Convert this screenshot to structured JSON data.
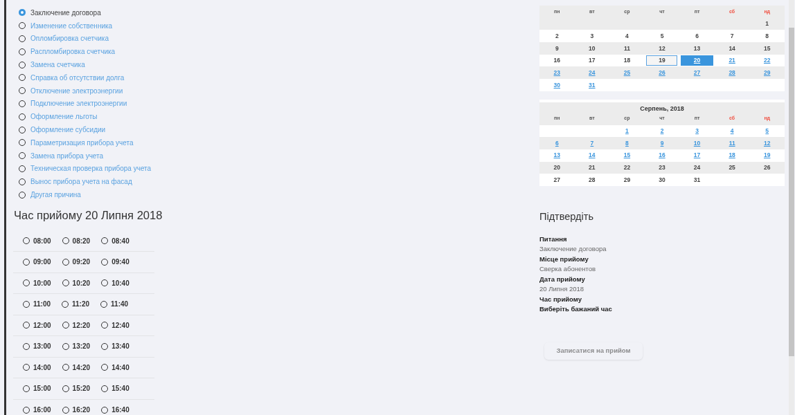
{
  "services": [
    {
      "label": "Заключение договора",
      "selected": true
    },
    {
      "label": "Изменение собственника",
      "selected": false
    },
    {
      "label": "Опломбировка счетчика",
      "selected": false
    },
    {
      "label": "Распломбировка счетчика",
      "selected": false
    },
    {
      "label": "Замена счетчика",
      "selected": false
    },
    {
      "label": "Справка об отсутствии долга",
      "selected": false
    },
    {
      "label": "Отключение электроэнергии",
      "selected": false
    },
    {
      "label": "Подключение электроэнергии",
      "selected": false
    },
    {
      "label": "Оформление льготы",
      "selected": false
    },
    {
      "label": "Оформление субсидии",
      "selected": false
    },
    {
      "label": "Параметризация прибора учета",
      "selected": false
    },
    {
      "label": "Замена прибора учета",
      "selected": false
    },
    {
      "label": "Техническая проверка прибора учета",
      "selected": false
    },
    {
      "label": "Вынос прибора учета на фасад",
      "selected": false
    },
    {
      "label": "Другая причина",
      "selected": false
    }
  ],
  "time_heading": "Час прийому 20 Липня 2018",
  "time_rows": [
    {
      "slots": [
        {
          "label": "08:00",
          "selected": false
        },
        {
          "label": "08:20",
          "selected": false
        },
        {
          "label": "08:40",
          "selected": false
        }
      ]
    },
    {
      "slots": [
        {
          "label": "09:00",
          "selected": false
        },
        {
          "label": "09:20",
          "selected": false
        },
        {
          "label": "09:40",
          "selected": false
        }
      ]
    },
    {
      "slots": [
        {
          "label": "10:00",
          "selected": false
        },
        {
          "label": "10:20",
          "selected": false
        },
        {
          "label": "10:40",
          "selected": false
        }
      ]
    },
    {
      "slots": [
        {
          "label": "11:00",
          "selected": false
        },
        {
          "label": "11:20",
          "selected": false
        },
        {
          "label": "11:40",
          "selected": false
        }
      ]
    },
    {
      "slots": [
        {
          "label": "12:00",
          "selected": false
        },
        {
          "label": "12:20",
          "selected": false
        },
        {
          "label": "12:40",
          "selected": false
        }
      ]
    },
    {
      "slots": [
        {
          "label": "13:00",
          "selected": false
        },
        {
          "label": "13:20",
          "selected": false
        },
        {
          "label": "13:40",
          "selected": false
        }
      ]
    },
    {
      "slots": [
        {
          "label": "14:00",
          "selected": false
        },
        {
          "label": "14:20",
          "selected": false
        },
        {
          "label": "14:40",
          "selected": false
        }
      ]
    },
    {
      "slots": [
        {
          "label": "15:00",
          "selected": false
        },
        {
          "label": "15:20",
          "selected": false
        },
        {
          "label": "15:40",
          "selected": false
        }
      ]
    },
    {
      "slots": [
        {
          "label": "16:00",
          "selected": false
        },
        {
          "label": "16:20",
          "selected": false
        },
        {
          "label": "16:40",
          "selected": false
        }
      ]
    }
  ],
  "calendars": [
    {
      "weekdays": [
        {
          "label": "пн",
          "weekend": false
        },
        {
          "label": "вт",
          "weekend": false
        },
        {
          "label": "ср",
          "weekend": false
        },
        {
          "label": "чт",
          "weekend": false
        },
        {
          "label": "пт",
          "weekend": false
        },
        {
          "label": "сб",
          "weekend": true
        },
        {
          "label": "нд",
          "weekend": true
        }
      ],
      "weeks": [
        [
          {
            "kind": "empty"
          },
          {
            "kind": "empty"
          },
          {
            "kind": "empty"
          },
          {
            "kind": "empty"
          },
          {
            "kind": "empty"
          },
          {
            "kind": "empty"
          },
          {
            "day": "1",
            "kind": "past",
            "selected": false,
            "today": false
          }
        ],
        [
          {
            "day": "2",
            "kind": "past",
            "selected": false,
            "today": false
          },
          {
            "day": "3",
            "kind": "past",
            "selected": false,
            "today": false
          },
          {
            "day": "4",
            "kind": "past",
            "selected": false,
            "today": false
          },
          {
            "day": "5",
            "kind": "past",
            "selected": false,
            "today": false
          },
          {
            "day": "6",
            "kind": "past",
            "selected": false,
            "today": false
          },
          {
            "day": "7",
            "kind": "past",
            "selected": false,
            "today": false
          },
          {
            "day": "8",
            "kind": "past",
            "selected": false,
            "today": false
          }
        ],
        [
          {
            "day": "9",
            "kind": "past",
            "selected": false,
            "today": false
          },
          {
            "day": "10",
            "kind": "past",
            "selected": false,
            "today": false
          },
          {
            "day": "11",
            "kind": "past",
            "selected": false,
            "today": false
          },
          {
            "day": "12",
            "kind": "past",
            "selected": false,
            "today": false
          },
          {
            "day": "13",
            "kind": "past",
            "selected": false,
            "today": false
          },
          {
            "day": "14",
            "kind": "past",
            "selected": false,
            "today": false
          },
          {
            "day": "15",
            "kind": "past",
            "selected": false,
            "today": false
          }
        ],
        [
          {
            "day": "16",
            "kind": "past",
            "selected": false,
            "today": false
          },
          {
            "day": "17",
            "kind": "past",
            "selected": false,
            "today": false
          },
          {
            "day": "18",
            "kind": "past",
            "selected": false,
            "today": false
          },
          {
            "day": "19",
            "kind": "past",
            "selected": false,
            "today": true
          },
          {
            "day": "20",
            "kind": "available",
            "selected": true,
            "today": false
          },
          {
            "day": "21",
            "kind": "available",
            "selected": false,
            "today": false
          },
          {
            "day": "22",
            "kind": "available",
            "selected": false,
            "today": false
          }
        ],
        [
          {
            "day": "23",
            "kind": "available",
            "selected": false,
            "today": false
          },
          {
            "day": "24",
            "kind": "available",
            "selected": false,
            "today": false
          },
          {
            "day": "25",
            "kind": "available",
            "selected": false,
            "today": false
          },
          {
            "day": "26",
            "kind": "available",
            "selected": false,
            "today": false
          },
          {
            "day": "27",
            "kind": "available",
            "selected": false,
            "today": false
          },
          {
            "day": "28",
            "kind": "available",
            "selected": false,
            "today": false
          },
          {
            "day": "29",
            "kind": "available",
            "selected": false,
            "today": false
          }
        ],
        [
          {
            "day": "30",
            "kind": "available",
            "selected": false,
            "today": false
          },
          {
            "day": "31",
            "kind": "available",
            "selected": false,
            "today": false
          },
          {
            "kind": "empty"
          },
          {
            "kind": "empty"
          },
          {
            "kind": "empty"
          },
          {
            "kind": "empty"
          },
          {
            "kind": "empty"
          }
        ]
      ]
    },
    {
      "title": "Серпень, 2018",
      "weekdays": [
        {
          "label": "пн",
          "weekend": false
        },
        {
          "label": "вт",
          "weekend": false
        },
        {
          "label": "ср",
          "weekend": false
        },
        {
          "label": "чт",
          "weekend": false
        },
        {
          "label": "пт",
          "weekend": false
        },
        {
          "label": "сб",
          "weekend": true
        },
        {
          "label": "нд",
          "weekend": true
        }
      ],
      "weeks": [
        [
          {
            "kind": "empty"
          },
          {
            "kind": "empty"
          },
          {
            "day": "1",
            "kind": "available",
            "selected": false,
            "today": false
          },
          {
            "day": "2",
            "kind": "available",
            "selected": false,
            "today": false
          },
          {
            "day": "3",
            "kind": "available",
            "selected": false,
            "today": false
          },
          {
            "day": "4",
            "kind": "available",
            "selected": false,
            "today": false
          },
          {
            "day": "5",
            "kind": "available",
            "selected": false,
            "today": false
          }
        ],
        [
          {
            "day": "6",
            "kind": "available",
            "selected": false,
            "today": false
          },
          {
            "day": "7",
            "kind": "available",
            "selected": false,
            "today": false
          },
          {
            "day": "8",
            "kind": "available",
            "selected": false,
            "today": false
          },
          {
            "day": "9",
            "kind": "available",
            "selected": false,
            "today": false
          },
          {
            "day": "10",
            "kind": "available",
            "selected": false,
            "today": false
          },
          {
            "day": "11",
            "kind": "available",
            "selected": false,
            "today": false
          },
          {
            "day": "12",
            "kind": "available",
            "selected": false,
            "today": false
          }
        ],
        [
          {
            "day": "13",
            "kind": "available",
            "selected": false,
            "today": false
          },
          {
            "day": "14",
            "kind": "available",
            "selected": false,
            "today": false
          },
          {
            "day": "15",
            "kind": "available",
            "selected": false,
            "today": false
          },
          {
            "day": "16",
            "kind": "available",
            "selected": false,
            "today": false
          },
          {
            "day": "17",
            "kind": "available",
            "selected": false,
            "today": false
          },
          {
            "day": "18",
            "kind": "available",
            "selected": false,
            "today": false
          },
          {
            "day": "19",
            "kind": "available",
            "selected": false,
            "today": false
          }
        ],
        [
          {
            "day": "20",
            "kind": "past",
            "selected": false,
            "today": false
          },
          {
            "day": "21",
            "kind": "past",
            "selected": false,
            "today": false
          },
          {
            "day": "22",
            "kind": "past",
            "selected": false,
            "today": false
          },
          {
            "day": "23",
            "kind": "past",
            "selected": false,
            "today": false
          },
          {
            "day": "24",
            "kind": "past",
            "selected": false,
            "today": false
          },
          {
            "day": "25",
            "kind": "past",
            "selected": false,
            "today": false
          },
          {
            "day": "26",
            "kind": "past",
            "selected": false,
            "today": false
          }
        ],
        [
          {
            "day": "27",
            "kind": "past",
            "selected": false,
            "today": false
          },
          {
            "day": "28",
            "kind": "past",
            "selected": false,
            "today": false
          },
          {
            "day": "29",
            "kind": "past",
            "selected": false,
            "today": false
          },
          {
            "day": "30",
            "kind": "past",
            "selected": false,
            "today": false
          },
          {
            "day": "31",
            "kind": "past",
            "selected": false,
            "today": false
          },
          {
            "kind": "empty"
          },
          {
            "kind": "empty"
          }
        ]
      ]
    }
  ],
  "confirm": {
    "title": "Підтвердіть",
    "items": [
      {
        "text": "Питання",
        "kind": "label"
      },
      {
        "text": "Заключение договора",
        "kind": "value"
      },
      {
        "text": "Місце прийому",
        "kind": "label"
      },
      {
        "text": "Сверка абонентов",
        "kind": "value"
      },
      {
        "text": "Дата прийому",
        "kind": "label"
      },
      {
        "text": "20 Липня 2018",
        "kind": "value"
      },
      {
        "text": "Час прийому",
        "kind": "label"
      },
      {
        "text": "Виберіть бажаний час",
        "kind": "prompt"
      }
    ],
    "button": {
      "label": "Записатися на прийом",
      "disabled": true
    }
  }
}
